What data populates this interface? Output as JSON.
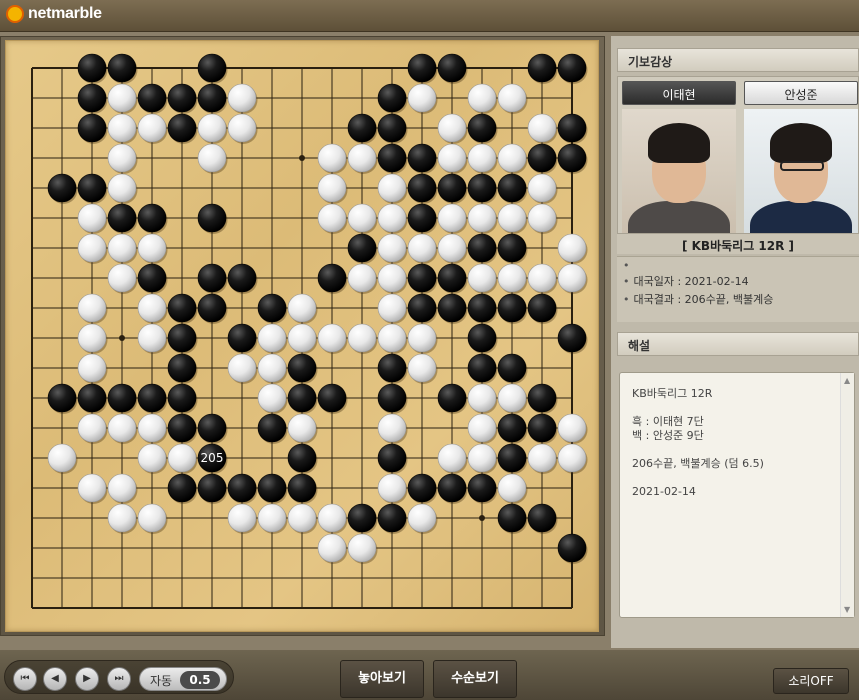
{
  "app": {
    "logo_text": "netmarble"
  },
  "board": {
    "size": 19,
    "stones": [
      "..BB..B......BB..BB.",
      "..BWBBBW....BW.WW...",
      "..BWWBWW...BB.WB.WB.",
      "...W..W...WWBBWWWBB.",
      ".BBW......W.WBBBBW..",
      "..WBB.B...WWWBWWWW..",
      "..WWW......BWWWBB.W.",
      "...WB.BB..BWWBBWWWW.",
      "..W.WBB.BW..WBBBBB..",
      "..W.WB.BWWWWWW.B..BB",
      "..W..B.WWB..BW.BB..B",
      ".BBBBB..WBB.B.BWWB.B",
      "..WWWBB.BW..W..WBBW.",
      ".W..WWB..B..B.WWBWW.",
      "..WW.BBBBB..WBBBW...",
      "...WW..WWWWBBW..BB.B",
      "..........WW......B.",
      "...................."
    ],
    "last_move": {
      "number": "205"
    }
  },
  "sidebar": {
    "kibo_heading": "기보감상",
    "black_player": "이태현",
    "white_player": "안성준",
    "match_title": "[ KB바둑리그 12R ]",
    "info_blank": "",
    "info_date": "대국일자 : 2021-02-14",
    "info_result": "대국결과 : 206수끝, 백불계승",
    "commentary_heading": "해설",
    "commentary_lines": [
      "KB바둑리그 12R",
      "",
      "흑 : 이태현 7단",
      "백 : 안성준 9단",
      "",
      "206수끝, 백불계승 (덤 6.5)",
      "",
      "2021-02-14"
    ]
  },
  "controls": {
    "auto_label": "자동",
    "auto_value": "0.5",
    "place_button": "놓아보기",
    "moves_button": "수순보기",
    "sound_button": "소리OFF"
  },
  "colors": {
    "black_stone": "#111111",
    "white_stone": "#f5f5f5",
    "board": "#e0c27f"
  }
}
